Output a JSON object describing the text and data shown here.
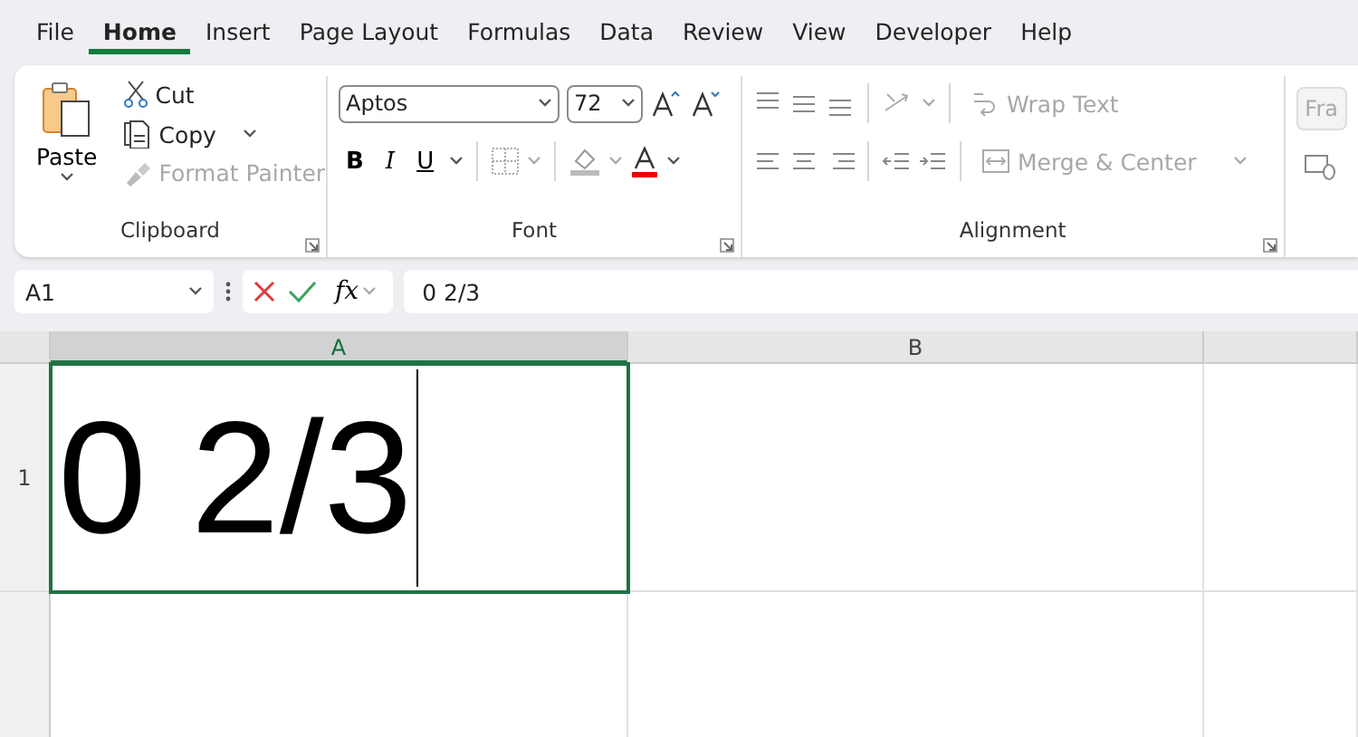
{
  "menu_tabs": [
    {
      "label": "File",
      "selected": false
    },
    {
      "label": "Home",
      "selected": true
    },
    {
      "label": "Insert",
      "selected": false
    },
    {
      "label": "Page Layout",
      "selected": false
    },
    {
      "label": "Formulas",
      "selected": false
    },
    {
      "label": "Data",
      "selected": false
    },
    {
      "label": "Review",
      "selected": false
    },
    {
      "label": "View",
      "selected": false
    },
    {
      "label": "Developer",
      "selected": false
    },
    {
      "label": "Help",
      "selected": false
    }
  ],
  "clipboard": {
    "paste": "Paste",
    "cut": {
      "label": "Cut",
      "disabled": false
    },
    "copy": {
      "label": "Copy",
      "disabled": false
    },
    "format_painter": {
      "label": "Format Painter",
      "disabled": true
    },
    "group_label": "Clipboard"
  },
  "font": {
    "name": "Aptos",
    "size": "72",
    "bold": "B",
    "italic": "I",
    "underline": "U",
    "group_label": "Font"
  },
  "alignment": {
    "wrap_text": {
      "label": "Wrap Text",
      "disabled": true
    },
    "merge_center": {
      "label": "Merge & Center",
      "disabled": true
    },
    "group_label": "Alignment"
  },
  "number": {
    "format": "Fra"
  },
  "formula_bar": {
    "name_box": "A1",
    "function_label": "fx",
    "value": "0 2/3"
  },
  "sheet": {
    "columns": [
      {
        "label": "A",
        "selected": true
      },
      {
        "label": "B",
        "selected": false
      },
      {
        "selected": false
      }
    ],
    "rows": [
      {
        "label": "1",
        "selected": false,
        "cells": [
          "0 2/3"
        ]
      }
    ],
    "active_cell": {
      "editing": true
    }
  }
}
